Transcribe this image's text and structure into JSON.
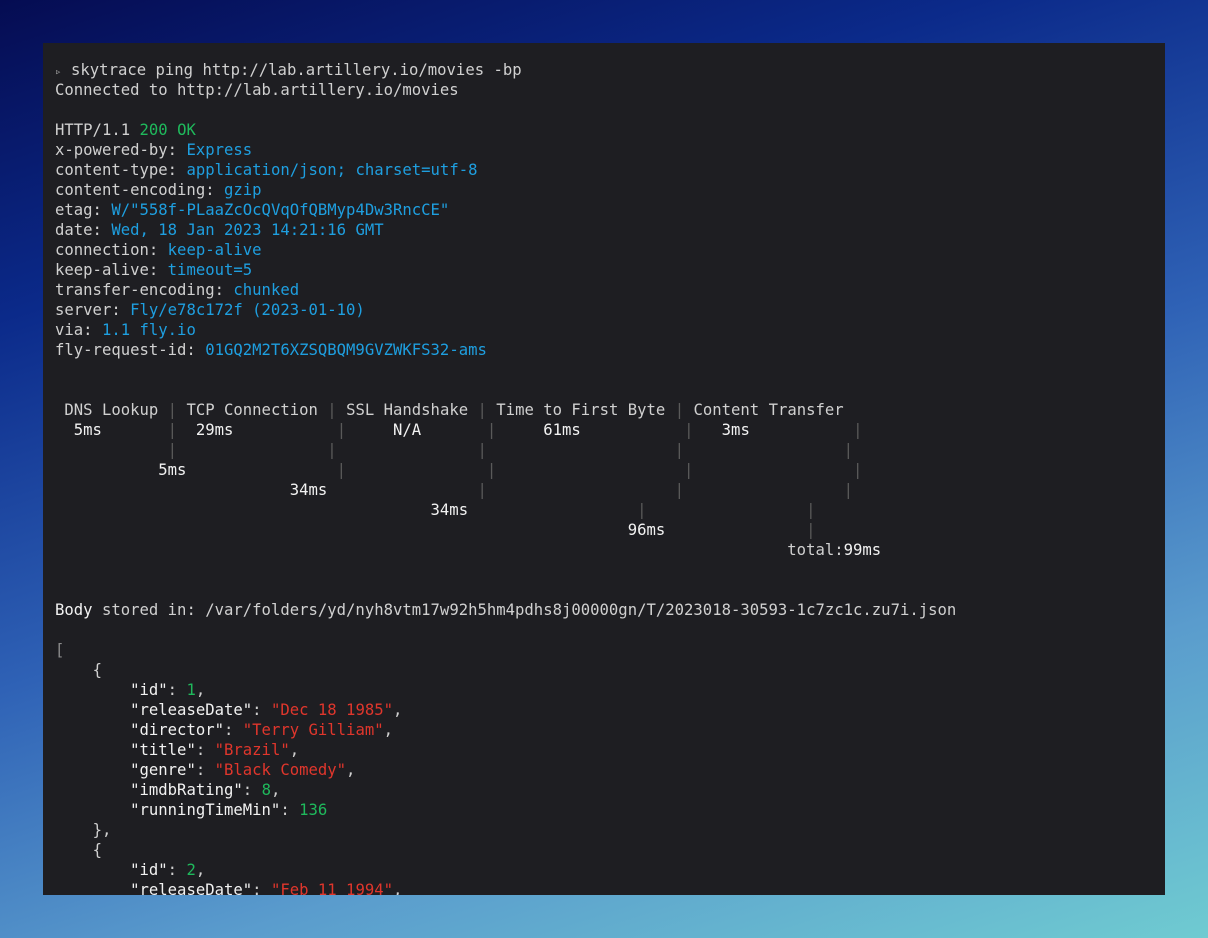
{
  "command": {
    "prompt_glyph": "▹",
    "text": "skytrace ping http://lab.artillery.io/movies -bp",
    "connected": "Connected to http://lab.artillery.io/movies"
  },
  "status": {
    "proto": "HTTP/1.1",
    "code": "200",
    "text": "OK"
  },
  "headers": [
    {
      "key": "x-powered-by:",
      "value": "Express"
    },
    {
      "key": "content-type:",
      "value": "application/json; charset=utf-8"
    },
    {
      "key": "content-encoding:",
      "value": "gzip"
    },
    {
      "key": "etag:",
      "value": "W/\"558f-PLaaZcOcQVqOfQBMyp4Dw3RncCE\""
    },
    {
      "key": "date:",
      "value": "Wed, 18 Jan 2023 14:21:16 GMT"
    },
    {
      "key": "connection:",
      "value": "keep-alive"
    },
    {
      "key": "keep-alive:",
      "value": "timeout=5"
    },
    {
      "key": "transfer-encoding:",
      "value": "chunked"
    },
    {
      "key": "server:",
      "value": "Fly/e78c172f (2023-01-10)"
    },
    {
      "key": "via:",
      "value": "1.1 fly.io"
    },
    {
      "key": "fly-request-id:",
      "value": "01GQ2M2T6XZSQBQM9GVZWKFS32-ams"
    }
  ],
  "timing": {
    "phases": [
      {
        "label": "DNS Lookup",
        "duration": "5ms",
        "cumulative": "5ms"
      },
      {
        "label": "TCP Connection",
        "duration": "29ms",
        "cumulative": "34ms"
      },
      {
        "label": "SSL Handshake",
        "duration": "N/A",
        "cumulative": "34ms"
      },
      {
        "label": "Time to First Byte",
        "duration": "61ms",
        "cumulative": "96ms"
      },
      {
        "label": "Content Transfer",
        "duration": "3ms",
        "cumulative": ""
      }
    ],
    "total_label": "total:",
    "total_value": "99ms"
  },
  "body": {
    "label": "Body",
    "stored_text": "stored in: /var/folders/yd/nyh8vtm17w92h5hm4pdhs8j00000gn/T/2023018-30593-1c7zc1c.zu7i.json"
  },
  "json_open": "[",
  "items": [
    {
      "open": "{",
      "fields": [
        {
          "key": "\"id\"",
          "value": "1",
          "type": "number"
        },
        {
          "key": "\"releaseDate\"",
          "value": "\"Dec 18 1985\"",
          "type": "string"
        },
        {
          "key": "\"director\"",
          "value": "\"Terry Gilliam\"",
          "type": "string"
        },
        {
          "key": "\"title\"",
          "value": "\"Brazil\"",
          "type": "string"
        },
        {
          "key": "\"genre\"",
          "value": "\"Black Comedy\"",
          "type": "string"
        },
        {
          "key": "\"imdbRating\"",
          "value": "8",
          "type": "number"
        },
        {
          "key": "\"runningTimeMin\"",
          "value": "136",
          "type": "number"
        }
      ],
      "close": "},"
    },
    {
      "open": "{",
      "fields": [
        {
          "key": "\"id\"",
          "value": "2",
          "type": "number"
        },
        {
          "key": "\"releaseDate\"",
          "value": "\"Feb 11 1994\"",
          "type": "string"
        }
      ]
    }
  ],
  "colors": {
    "background": "#1e1e22",
    "text": "#d0d0d0",
    "header_value": "#1e9fe0",
    "status_ok": "#1fb95c",
    "json_number": "#1fb95c",
    "json_string": "#e0362c",
    "json_key": "#f2f2f2"
  }
}
